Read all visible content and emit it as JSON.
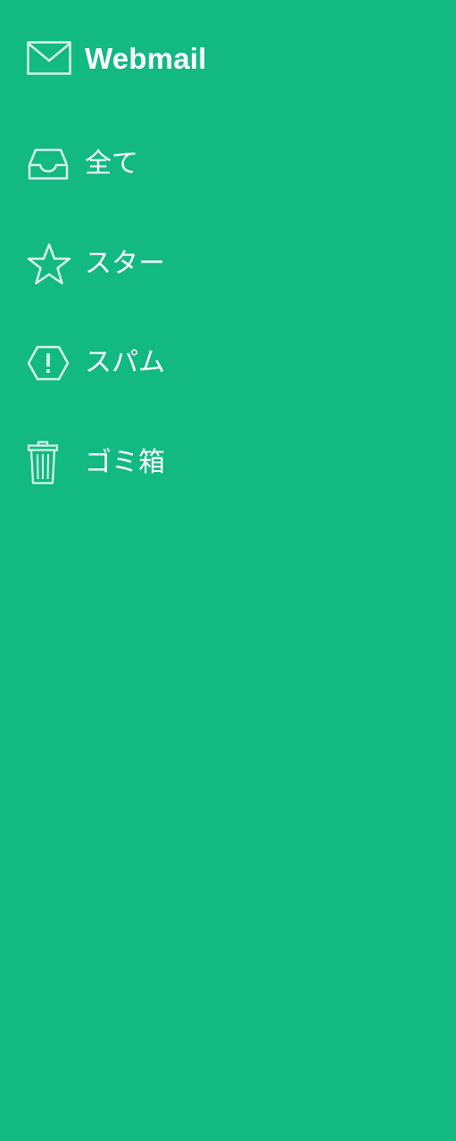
{
  "app": {
    "title": "Webmail",
    "logo_icon": "mail-envelope-icon"
  },
  "sidebar": {
    "items": [
      {
        "label": "全て",
        "icon": "inbox-tray-icon"
      },
      {
        "label": "スター",
        "icon": "star-icon"
      },
      {
        "label": "スパム",
        "icon": "spam-warning-icon"
      },
      {
        "label": "ゴミ箱",
        "icon": "trash-icon"
      }
    ]
  },
  "colors": {
    "background": "#12b981",
    "text": "#ffffff",
    "icon_stroke": "#d8f5ea"
  }
}
